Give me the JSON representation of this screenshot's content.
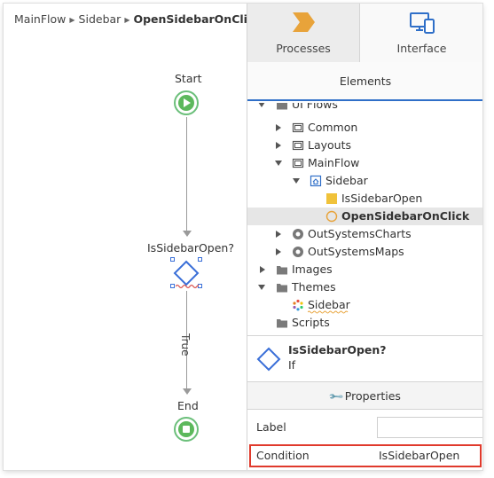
{
  "breadcrumb": {
    "items": [
      "MainFlow",
      "Sidebar"
    ],
    "current": "OpenSidebarOnClick"
  },
  "flow": {
    "start_label": "Start",
    "if_label": "IsSidebarOpen?",
    "true_label": "True",
    "end_label": "End"
  },
  "tabs": {
    "processes": "Processes",
    "interface": "Interface"
  },
  "elements_header": "Elements",
  "tree": {
    "ui_flows": "UI Flows",
    "common": "Common",
    "layouts": "Layouts",
    "mainflow": "MainFlow",
    "sidebar": "Sidebar",
    "is_sidebar_open": "IsSidebarOpen",
    "open_sidebar_on_click": "OpenSidebarOnClick",
    "outsystems_charts": "OutSystemsCharts",
    "outsystems_maps": "OutSystemsMaps",
    "images": "Images",
    "themes": "Themes",
    "sidebar_theme": "Sidebar",
    "scripts": "Scripts"
  },
  "properties_header": {
    "title": "IsSidebarOpen?",
    "subtitle": "If"
  },
  "properties_tab": "Properties",
  "props": {
    "label_name": "Label",
    "label_value": "",
    "condition_name": "Condition",
    "condition_value": "IsSidebarOpen"
  },
  "colors": {
    "accent": "#2f6fc8",
    "start_end_green": "#5cb85c",
    "highlight_red": "#e03a2c",
    "if_blue": "#3a6fd8",
    "processes_icon": "#e8a33a"
  },
  "icons": {
    "processes": "processes-chevron-icon",
    "interface": "devices-icon",
    "wrench": "wrench-icon"
  }
}
